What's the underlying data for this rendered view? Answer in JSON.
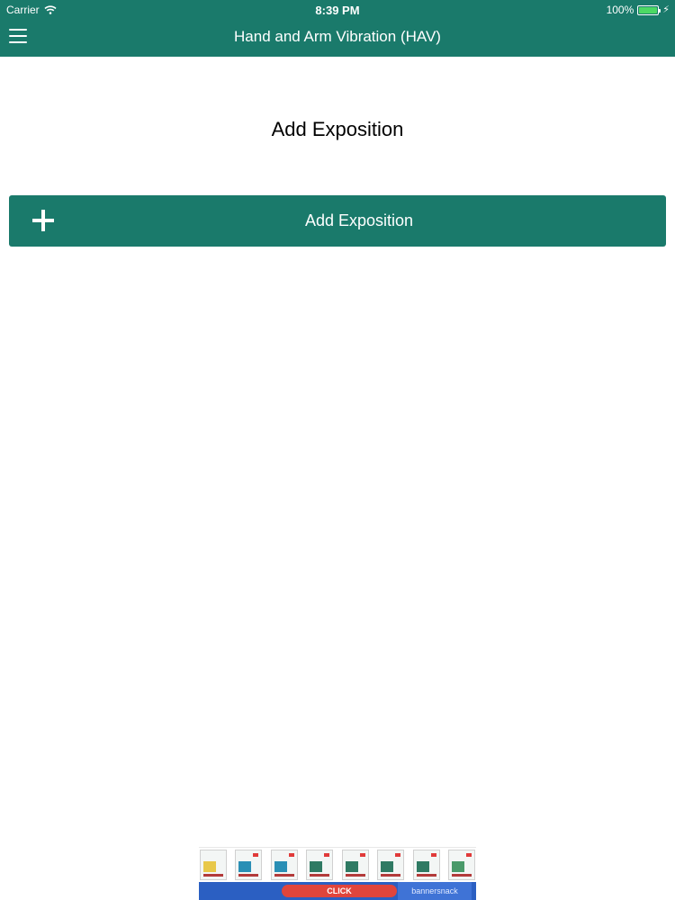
{
  "status_bar": {
    "carrier": "Carrier",
    "time": "8:39 PM",
    "battery": "100%",
    "icons": [
      "wifi-icon",
      "battery-icon",
      "charging-bolt-icon"
    ]
  },
  "navbar": {
    "title": "Hand and Arm Vibration (HAV)",
    "menu_icon": "hamburger-menu-icon"
  },
  "main": {
    "heading": "Add Exposition",
    "add_button": {
      "label": "Add Exposition",
      "icon": "plus-icon"
    }
  },
  "ad_banner": {
    "cta": "CLICK",
    "brand": "bannersnack"
  },
  "colors": {
    "primary": "#1a7a6b",
    "background": "#ffffff",
    "text": "#000000",
    "ad_blue": "#2b5fc2",
    "ad_red": "#e0453c"
  }
}
